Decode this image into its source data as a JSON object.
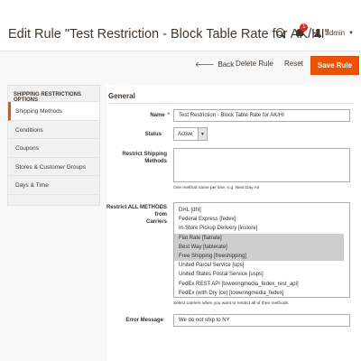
{
  "header": {
    "title": "Edit Rule \"Test Restriction - Block Table Rate for AK/HI\"",
    "notification_count": "1",
    "user": "admin"
  },
  "actions": {
    "back_arrow": "🡐",
    "back": "Back",
    "delete": "Delete Rule",
    "reset": "Reset",
    "save": "Save Rule"
  },
  "sidebar": {
    "title": "SHIPPING RESTRICTIONS OPTIONS",
    "items": [
      {
        "label": "Shipping Methods",
        "active": true
      },
      {
        "label": "Conditions",
        "active": false
      },
      {
        "label": "Coupons",
        "active": false
      },
      {
        "label": "Stores & Customer Groups",
        "active": false
      },
      {
        "label": "Days & Time",
        "active": false
      }
    ]
  },
  "form": {
    "section_title": "General",
    "name_label": "Name",
    "name_value": "Test Restriction - Block Table Rate for AK/HI",
    "status_label": "Status",
    "status_value": "Active",
    "restrict_methods_label": "Restrict Shipping Methods",
    "restrict_methods_note": "One method name per line, e.g. Next Day Air",
    "restrict_carriers_label_1": "Restrict ALL METHODS from",
    "restrict_carriers_label_2": "Carriers",
    "carriers": [
      {
        "label": "DHL [dhl]",
        "selected": false
      },
      {
        "label": "Federal Express [fedex]",
        "selected": false
      },
      {
        "label": "In-Store Pickup Delivery [instore]",
        "selected": false
      },
      {
        "label": "Flat Rate [flatrate]",
        "selected": true
      },
      {
        "label": "Best Way [tablerate]",
        "selected": true
      },
      {
        "label": "Free Shipping [freeshipping]",
        "selected": true
      },
      {
        "label": "United Parcel Service [ups]",
        "selected": false
      },
      {
        "label": "United States Postal Service [usps]",
        "selected": false
      },
      {
        "label": "FedEx REST API [toweringmedia_fedex_rest_api]",
        "selected": false
      },
      {
        "label": "FedEx (with Dry Ice) [toweringmedia_fedex]",
        "selected": false
      }
    ],
    "carriers_note": "Select carriers when you want to restrict all of their methods.",
    "error_label": "Error Message",
    "error_value": "We do not ship to NY"
  }
}
